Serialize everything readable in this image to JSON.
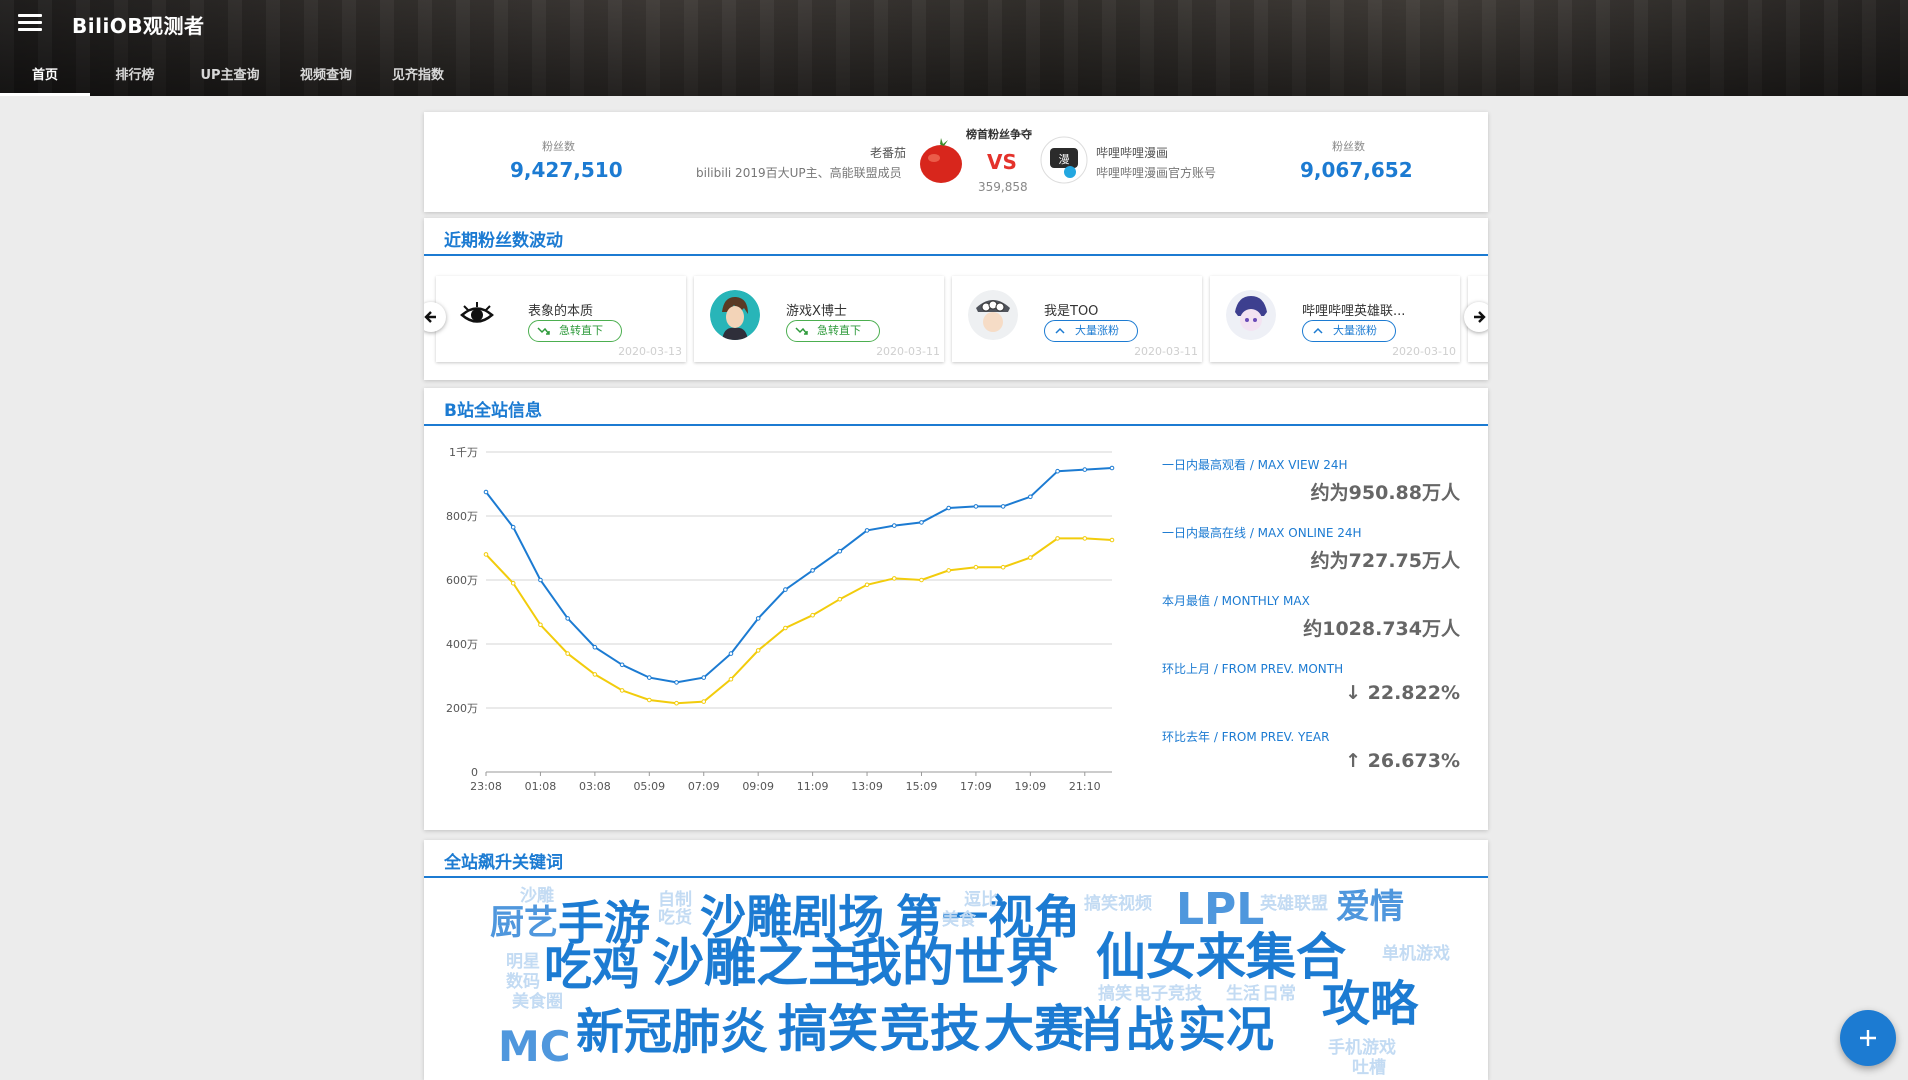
{
  "app": {
    "title": "BiliOB观测者"
  },
  "nav": {
    "tabs": [
      "首页",
      "排行榜",
      "UP主查询",
      "视频查询",
      "见齐指数"
    ]
  },
  "battle": {
    "title": "榜首粉丝争夺",
    "vs": "VS",
    "gap": "359,858",
    "left": {
      "fans_label": "粉丝数",
      "fans": "9,427,510",
      "name": "老番茄",
      "desc": "bilibili 2019百大UP主、高能联盟成员"
    },
    "right": {
      "fans_label": "粉丝数",
      "fans": "9,067,652",
      "name": "哔哩哔哩漫画",
      "desc": "哔哩哔哩漫画官方账号"
    }
  },
  "fluctuation": {
    "title": "近期粉丝数波动",
    "items": [
      {
        "name": "表象的本质",
        "tag": "急转直下",
        "date": "2020-03-13",
        "dir": "down"
      },
      {
        "name": "游戏X博士",
        "tag": "急转直下",
        "date": "2020-03-11",
        "dir": "down"
      },
      {
        "name": "我是TOO",
        "tag": "大量涨粉",
        "date": "2020-03-11",
        "dir": "up"
      },
      {
        "name": "哔哩哔哩英雄联...",
        "tag": "大量涨粉",
        "date": "2020-03-10",
        "dir": "up"
      }
    ]
  },
  "site_info": {
    "title": "B站全站信息",
    "stats": [
      {
        "label": "一日内最高观看 / MAX VIEW 24H",
        "value": "约为950.88万人"
      },
      {
        "label": "一日内最高在线 / MAX ONLINE 24H",
        "value": "约为727.75万人"
      },
      {
        "label": "本月最值 / MONTHLY MAX",
        "value": "约1028.734万人"
      },
      {
        "label": "环比上月 / FROM PREV. MONTH",
        "value": "↓ 22.822%"
      },
      {
        "label": "环比去年 / FROM PREV. YEAR",
        "value": "↑ 26.673%"
      }
    ]
  },
  "chart_data": {
    "type": "line",
    "x": [
      "23:08",
      "00:08",
      "01:08",
      "02:08",
      "03:08",
      "04:08",
      "05:09",
      "06:09",
      "07:09",
      "08:09",
      "09:09",
      "10:09",
      "11:09",
      "12:09",
      "13:09",
      "14:09",
      "15:09",
      "16:09",
      "17:09",
      "18:09",
      "19:09",
      "20:09",
      "21:10",
      "22:10"
    ],
    "x_tick_labels": [
      "23:08",
      "01:08",
      "03:08",
      "05:09",
      "07:09",
      "09:09",
      "11:09",
      "13:09",
      "15:09",
      "17:09",
      "19:09",
      "21:10"
    ],
    "y_tick_labels": [
      "0",
      "200万",
      "400万",
      "600万",
      "800万",
      "1千万"
    ],
    "ylim": [
      0,
      1000
    ],
    "series": [
      {
        "color": "#1c7bd2",
        "values": [
          875,
          765,
          600,
          480,
          390,
          335,
          295,
          280,
          295,
          370,
          480,
          570,
          630,
          690,
          755,
          770,
          780,
          825,
          830,
          830,
          860,
          940,
          945,
          950
        ]
      },
      {
        "color": "#f2cc0c",
        "values": [
          680,
          590,
          460,
          370,
          305,
          255,
          225,
          215,
          220,
          290,
          380,
          450,
          490,
          540,
          585,
          605,
          600,
          630,
          640,
          640,
          670,
          730,
          730,
          725
        ]
      }
    ],
    "grid": true
  },
  "keywords": {
    "title": "全站飙升关键词",
    "words": [
      {
        "text": "沙雕",
        "tone": "pale"
      },
      {
        "text": "厨艺",
        "tone": "light"
      },
      {
        "text": "手游",
        "tone": "main"
      },
      {
        "text": "自制",
        "tone": "pale"
      },
      {
        "text": "吃货",
        "tone": "pale"
      },
      {
        "text": "沙雕剧场",
        "tone": "main"
      },
      {
        "text": "第一视角",
        "tone": "main"
      },
      {
        "text": "逗比",
        "tone": "pale"
      },
      {
        "text": "美食",
        "tone": "pale"
      },
      {
        "text": "搞笑视频",
        "tone": "pale"
      },
      {
        "text": "LPL",
        "tone": "light"
      },
      {
        "text": "英雄联盟",
        "tone": "pale"
      },
      {
        "text": "爱情",
        "tone": "light"
      },
      {
        "text": "明星",
        "tone": "pale"
      },
      {
        "text": "数码",
        "tone": "pale"
      },
      {
        "text": "吃鸡",
        "tone": "main"
      },
      {
        "text": "沙雕之主",
        "tone": "main"
      },
      {
        "text": "我的世界",
        "tone": "main"
      },
      {
        "text": "仙女来集合",
        "tone": "main"
      },
      {
        "text": "单机游戏",
        "tone": "pale"
      },
      {
        "text": "美食圈",
        "tone": "pale"
      },
      {
        "text": "搞笑",
        "tone": "pale"
      },
      {
        "text": "电子竞技",
        "tone": "pale"
      },
      {
        "text": "生活",
        "tone": "pale"
      },
      {
        "text": "日常",
        "tone": "pale"
      },
      {
        "text": "攻略",
        "tone": "main"
      },
      {
        "text": "MC",
        "tone": "light"
      },
      {
        "text": "新冠肺炎",
        "tone": "main"
      },
      {
        "text": "搞笑",
        "tone": "main"
      },
      {
        "text": "竞技",
        "tone": "main"
      },
      {
        "text": "大赛",
        "tone": "main"
      },
      {
        "text": "肖战",
        "tone": "main"
      },
      {
        "text": "实况",
        "tone": "main"
      },
      {
        "text": "手机游戏",
        "tone": "pale"
      },
      {
        "text": "吐槽",
        "tone": "pale"
      }
    ]
  },
  "colors": {
    "accent": "#1c7bd2",
    "vs": "#e4322b",
    "down": "#4caf50",
    "yellow": "#f2cc0c"
  },
  "icons": {
    "menu": "menu-icon",
    "prev": "arrow-left-icon",
    "next": "arrow-right-icon",
    "fab": "plus-icon"
  }
}
